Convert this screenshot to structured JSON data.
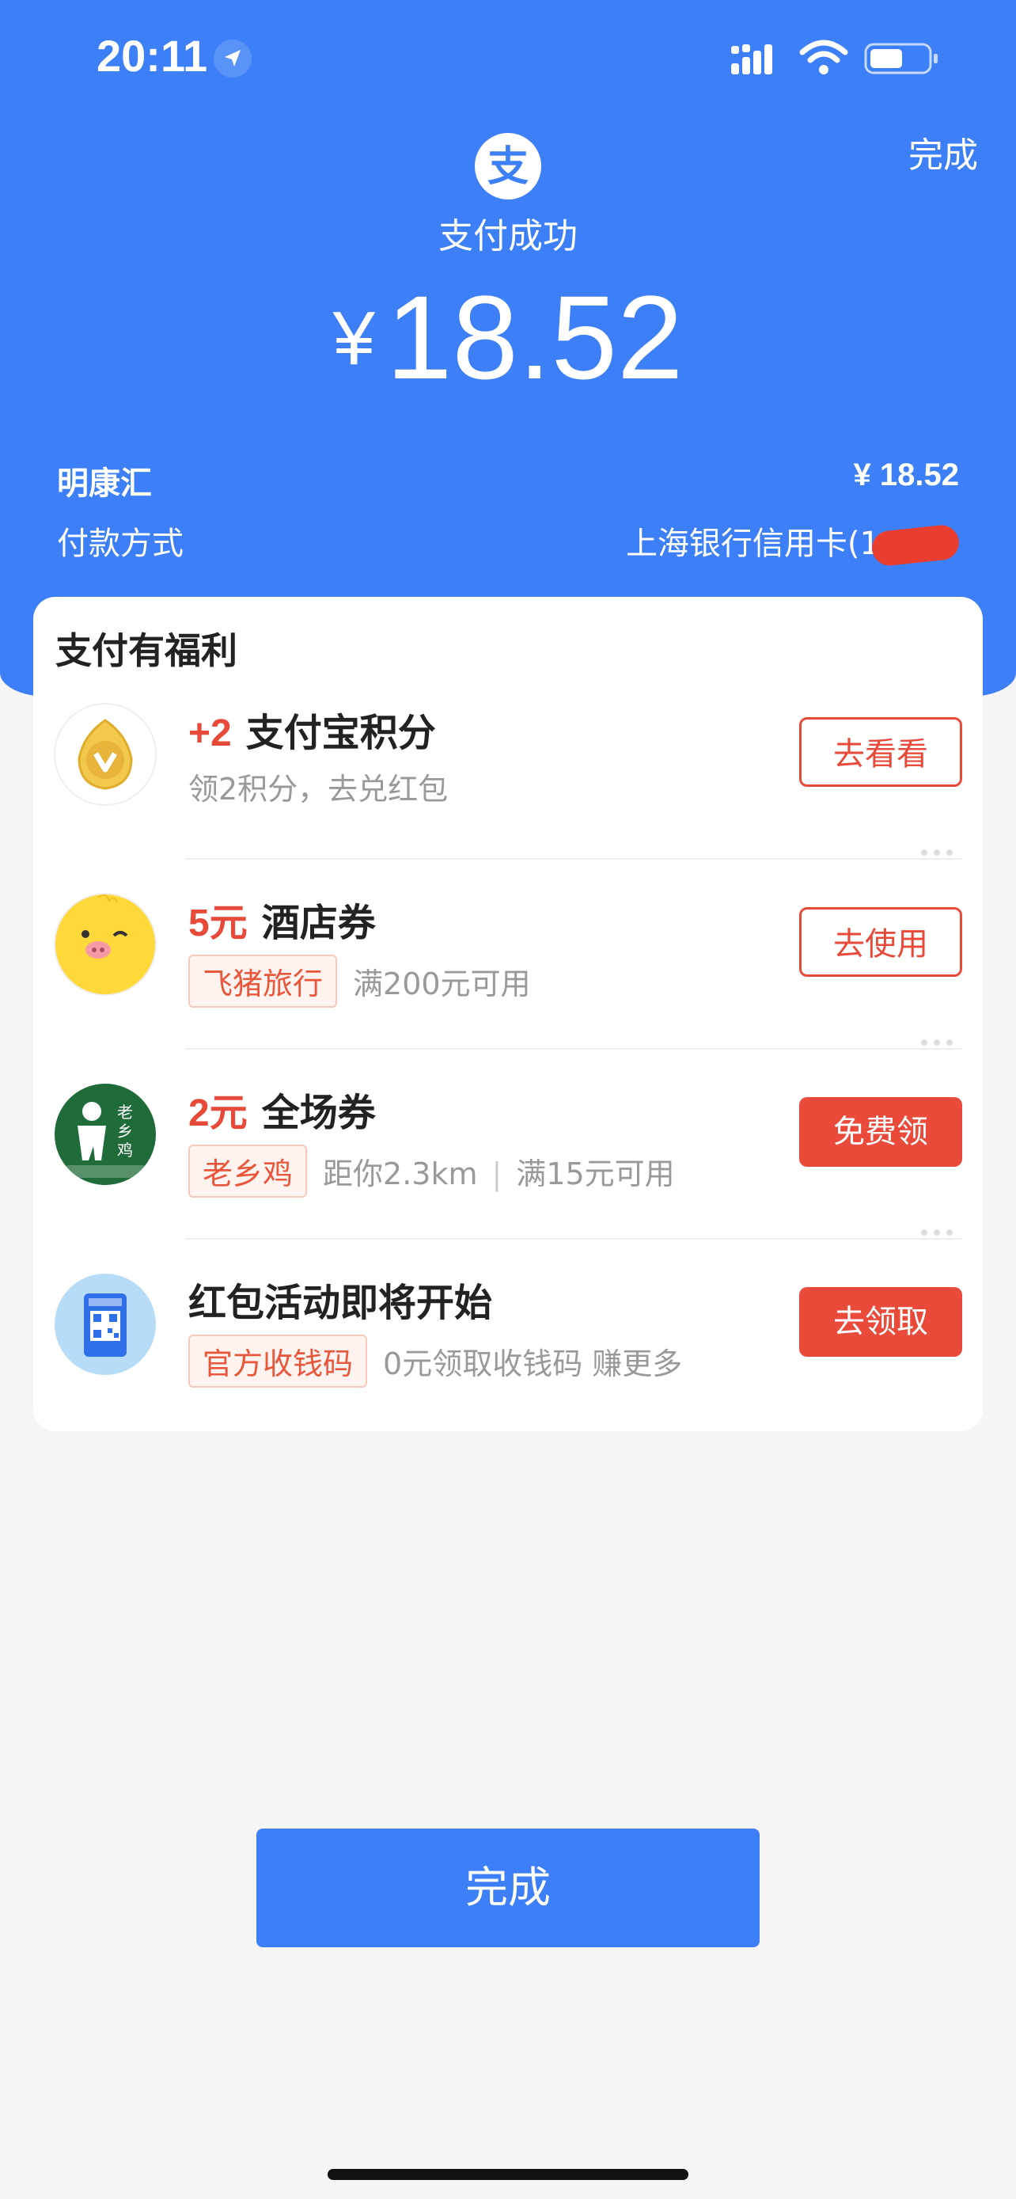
{
  "status_bar": {
    "time": "20:11",
    "icons": [
      "location-arrow-icon",
      "signal-icon",
      "wifi-icon",
      "battery-icon"
    ]
  },
  "header": {
    "done_label": "完成",
    "logo_icon": "alipay-logo-icon",
    "status_text": "支付成功",
    "currency_symbol": "¥",
    "amount": "18.52"
  },
  "summary": {
    "merchant": "明康汇",
    "merchant_amount": "¥ 18.52",
    "method_label": "付款方式",
    "method_value": "上海银行信用卡(1"
  },
  "benefits": {
    "title": "支付有福利",
    "items": [
      {
        "highlight": "+2",
        "title": "支付宝积分",
        "tag": "",
        "desc": "领2积分，去兑红包",
        "desc2": "",
        "button": "去看看",
        "button_style": "outline",
        "icon": "points-coin-icon"
      },
      {
        "highlight": "5元",
        "title": "酒店券",
        "tag": "飞猪旅行",
        "desc": "满200元可用",
        "desc2": "",
        "button": "去使用",
        "button_style": "outline",
        "icon": "fliggy-pig-icon"
      },
      {
        "highlight": "2元",
        "title": "全场券",
        "tag": "老乡鸡",
        "desc": "距你2.3km",
        "desc2": "满15元可用",
        "button": "免费领",
        "button_style": "solid",
        "icon": "laoxiangji-logo-icon"
      },
      {
        "highlight": "",
        "title": "红包活动即将开始",
        "tag": "官方收钱码",
        "desc": "0元领取收钱码 赚更多",
        "desc2": "",
        "button": "去领取",
        "button_style": "solid",
        "icon": "qr-code-stand-icon"
      }
    ]
  },
  "footer": {
    "done_label": "完成"
  },
  "colors": {
    "brand_blue": "#3d7ff6",
    "accent_red": "#e84a3a",
    "background": "#f5f5f5"
  }
}
